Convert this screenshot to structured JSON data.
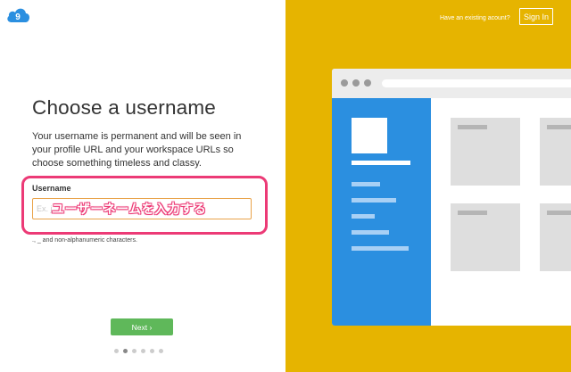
{
  "app": {
    "logo_glyph": "9",
    "logo_color": "#2b8fe0"
  },
  "onboarding": {
    "title": "Choose a username",
    "description": "Your username is permanent and will be seen in your profile URL and your workspace URLs so choose something timeless and classy.",
    "field_label": "Username",
    "input_placeholder": "Ex. j",
    "input_value": "",
    "hint": "., _ and non-alphanumeric characters.",
    "annotation": "ユーザーネームを入力する",
    "annotation_color": "#ec3a76",
    "next_label": "Next ›",
    "steps": {
      "count": 6,
      "active_index": 1
    }
  },
  "header": {
    "existing_account": "Have an existing acount?",
    "signin_label": "Sign In"
  },
  "colors": {
    "right_panel": "#e6b400",
    "next_button": "#5fb85a",
    "input_border": "#e9a34a"
  }
}
